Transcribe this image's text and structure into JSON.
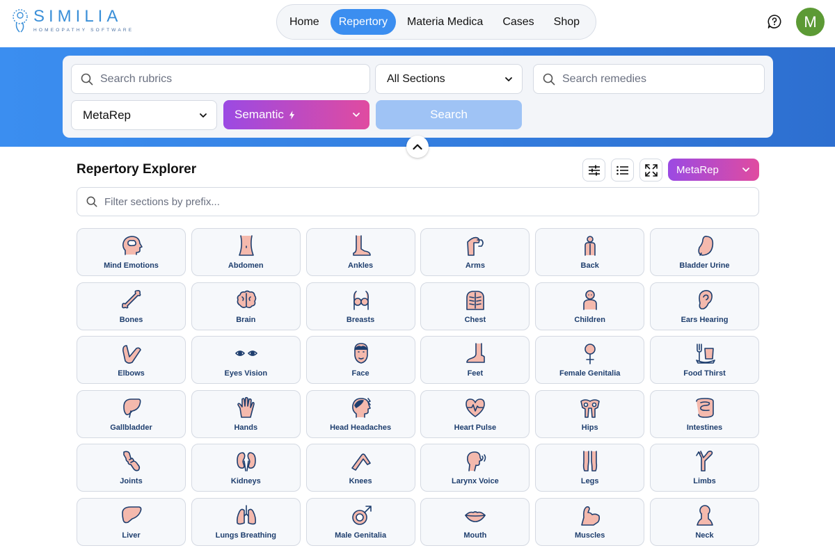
{
  "app": {
    "logo_name": "SIMILIA",
    "logo_sub": "HOMEOPATHY SOFTWARE",
    "user_initial": "M"
  },
  "nav": {
    "items": [
      {
        "label": "Home",
        "active": false
      },
      {
        "label": "Repertory",
        "active": true
      },
      {
        "label": "Materia Medica",
        "active": false
      },
      {
        "label": "Cases",
        "active": false
      },
      {
        "label": "Shop",
        "active": false
      }
    ]
  },
  "search": {
    "rubrics_placeholder": "Search rubrics",
    "sections_value": "All Sections",
    "remedies_placeholder": "Search remedies",
    "repertory_value": "MetaRep",
    "mode_value": "Semantic",
    "search_button": "Search"
  },
  "explorer": {
    "title": "Repertory Explorer",
    "repertory_pill": "MetaRep",
    "filter_placeholder": "Filter sections by prefix...",
    "sections": [
      {
        "label": "Mind Emotions",
        "icon": "head-brain-icon"
      },
      {
        "label": "Abdomen",
        "icon": "abdomen-icon"
      },
      {
        "label": "Ankles",
        "icon": "ankle-icon"
      },
      {
        "label": "Arms",
        "icon": "arm-icon"
      },
      {
        "label": "Back",
        "icon": "back-icon"
      },
      {
        "label": "Bladder Urine",
        "icon": "bladder-icon"
      },
      {
        "label": "Bones",
        "icon": "bone-icon"
      },
      {
        "label": "Brain",
        "icon": "brain-icon"
      },
      {
        "label": "Breasts",
        "icon": "breasts-icon"
      },
      {
        "label": "Chest",
        "icon": "ribcage-icon"
      },
      {
        "label": "Children",
        "icon": "child-icon"
      },
      {
        "label": "Ears Hearing",
        "icon": "ear-icon"
      },
      {
        "label": "Elbows",
        "icon": "elbow-icon"
      },
      {
        "label": "Eyes Vision",
        "icon": "eyes-icon"
      },
      {
        "label": "Face",
        "icon": "face-icon"
      },
      {
        "label": "Feet",
        "icon": "foot-icon"
      },
      {
        "label": "Female Genitalia",
        "icon": "female-symbol-icon"
      },
      {
        "label": "Food Thirst",
        "icon": "food-drink-icon"
      },
      {
        "label": "Gallbladder",
        "icon": "gallbladder-icon"
      },
      {
        "label": "Hands",
        "icon": "hand-icon"
      },
      {
        "label": "Head Headaches",
        "icon": "headache-icon"
      },
      {
        "label": "Heart Pulse",
        "icon": "heart-pulse-icon"
      },
      {
        "label": "Hips",
        "icon": "hips-icon"
      },
      {
        "label": "Intestines",
        "icon": "intestines-icon"
      },
      {
        "label": "Joints",
        "icon": "joint-icon"
      },
      {
        "label": "Kidneys",
        "icon": "kidneys-icon"
      },
      {
        "label": "Knees",
        "icon": "knee-icon"
      },
      {
        "label": "Larynx Voice",
        "icon": "voice-icon"
      },
      {
        "label": "Legs",
        "icon": "legs-icon"
      },
      {
        "label": "Limbs",
        "icon": "limbs-icon"
      },
      {
        "label": "Liver",
        "icon": "liver-icon"
      },
      {
        "label": "Lungs Breathing",
        "icon": "lungs-icon"
      },
      {
        "label": "Male Genitalia",
        "icon": "male-symbol-icon"
      },
      {
        "label": "Mouth",
        "icon": "lips-icon"
      },
      {
        "label": "Muscles",
        "icon": "muscle-icon"
      },
      {
        "label": "Neck",
        "icon": "neck-icon"
      }
    ]
  },
  "colors": {
    "accent": "#3b8ef0",
    "gradient_start": "#9b4ae3",
    "gradient_end": "#e04ba0",
    "icon_stroke": "#1e3e6e",
    "icon_fill": "#f4b9ad",
    "avatar": "#5c9a35"
  }
}
